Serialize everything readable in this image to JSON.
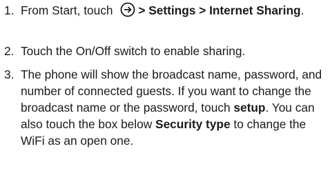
{
  "steps": [
    {
      "number": "1.",
      "pre": "From Start, touch",
      "icon": "circle-right-arrow-icon",
      "path": "> Settings > Internet Sharing",
      "post": "."
    },
    {
      "number": "2.",
      "text": "Touch the On/Off switch to enable sharing."
    },
    {
      "number": "3.",
      "a": "The phone will show the broadcast name, password, and number of connected guests. If you want to change the broadcast name or the password, touch",
      "b": "setup",
      "c": ". You can also touch the box below",
      "d": "Security type",
      "e": "to change the WiFi as an open one."
    }
  ]
}
